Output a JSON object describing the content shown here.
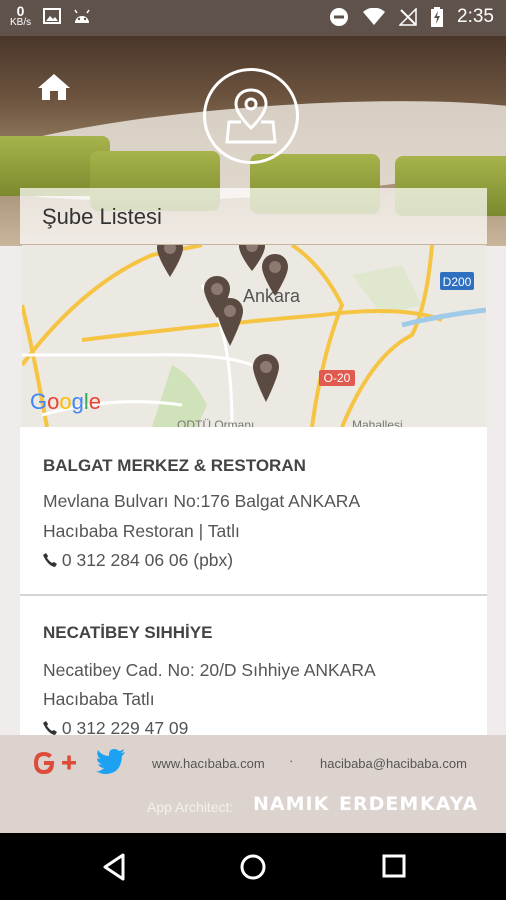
{
  "status_bar": {
    "kb_value": "0",
    "kb_unit": "KB/s",
    "time": "2:35",
    "icons": [
      "image-icon",
      "android-icon",
      "dnd-icon",
      "wifi-icon",
      "no-signal-icon",
      "battery-charging-icon"
    ]
  },
  "header": {
    "title": "Şube Listesi",
    "home_icon": "home-icon",
    "logo_icon": "map-pin-icon"
  },
  "map": {
    "city_label": "Ankara",
    "road_badge_1": "D200",
    "road_badge_2": "O-20",
    "google_letters": [
      "G",
      "o",
      "o",
      "g",
      "l",
      "e"
    ],
    "google_colors": [
      "#4285F4",
      "#EA4335",
      "#FBBC05",
      "#4285F4",
      "#34A853",
      "#EA4335"
    ],
    "bottom_cut_1": "ODTÜ Ormanı",
    "bottom_cut_2": "Mahallesi"
  },
  "branches": [
    {
      "name": "BALGAT MERKEZ & RESTORAN",
      "address": "Mevlana Bulvarı No:176 Balgat ANKARA",
      "type": "Hacıbaba Restoran | Tatlı",
      "phone": "0 312 284 06 06 (pbx)"
    },
    {
      "name": "NECATİBEY SIHHİYE",
      "address": "Necatibey Cad. No: 20/D Sıhhiye ANKARA",
      "type": "Hacıbaba Tatlı",
      "phone": "0 312 229 47 09"
    }
  ],
  "footer": {
    "website": "www.hacıbaba.com",
    "separator": "·",
    "email": "hacibaba@hacibaba.com",
    "app_architect_label": "App Architect:",
    "architect_first": "NAMIK",
    "architect_middle": "ERDEM",
    "architect_last": "KAYA"
  },
  "colors": {
    "status_bar": "#5f524b",
    "google_plus": "#dd4b39",
    "twitter": "#1da1f2",
    "pin": "#5b4a42"
  }
}
